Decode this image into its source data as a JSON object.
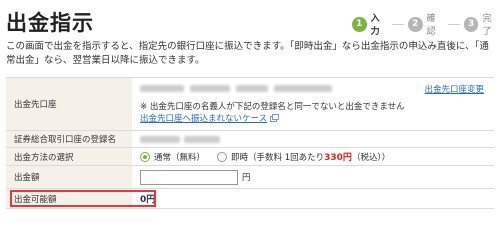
{
  "header": {
    "title": "出金指示"
  },
  "steps": [
    {
      "number": "1",
      "label": "入力"
    },
    {
      "number": "2",
      "label": "確認"
    },
    {
      "number": "3",
      "label": "完了"
    }
  ],
  "intro": "この画面で出金を指示すると、指定先の銀行口座に振込できます。「即時出金」なら出金指示の申込み直後に、「通常出金」なら、翌営業日以降に振込できます。",
  "form": {
    "account": {
      "label": "出金先口座",
      "change_link": "出金先口座変更",
      "warning": "※ 出金先口座の名義人が下記の登録名と同一でないと出金できません",
      "help_link": "出金先口座へ振込まれないケース"
    },
    "registered_name": {
      "label": "証券総合取引口座の登録名"
    },
    "method": {
      "label": "出金方法の選択",
      "normal": "通常（無料）",
      "instant_prefix": "即時（手数料 1回あたり",
      "instant_fee": "330円",
      "instant_suffix": "（税込））"
    },
    "amount": {
      "label": "出金額",
      "unit": "円",
      "value": ""
    },
    "available": {
      "label": "出金可能額",
      "value": "0円"
    }
  },
  "colors": {
    "accent_green": "#7cb342",
    "link_blue": "#2a6ebb",
    "fee_red": "#d9231e",
    "highlight_red": "#e03a3a",
    "label_bg": "#f5f1e8"
  }
}
